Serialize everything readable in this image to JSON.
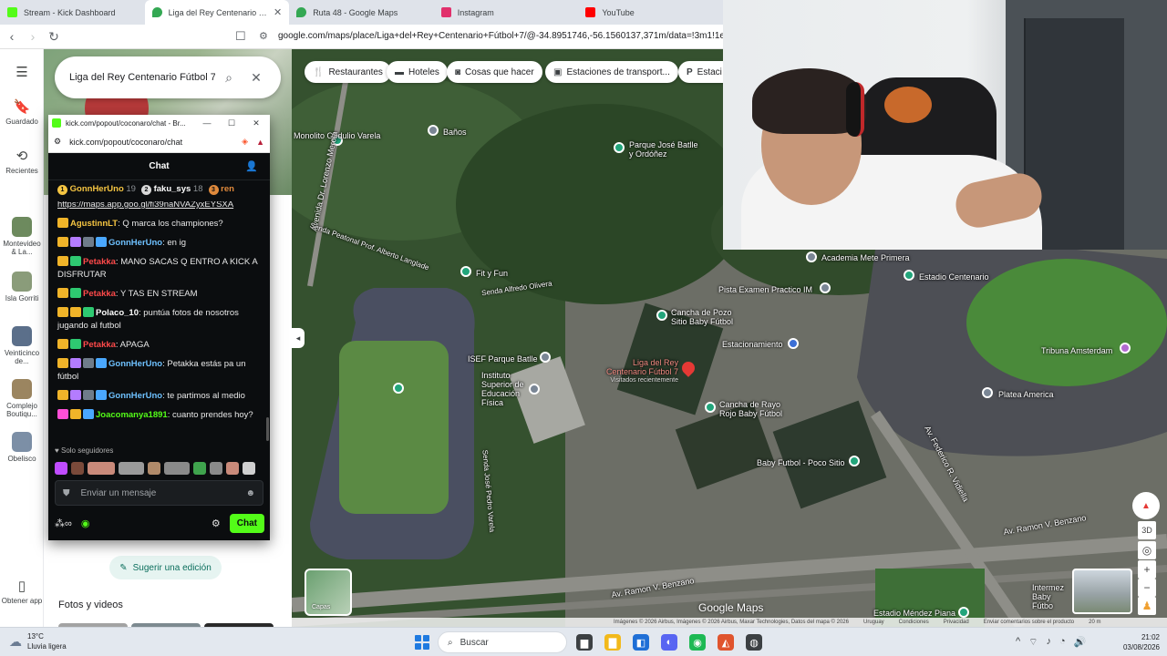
{
  "browser": {
    "tabs": [
      {
        "title": "Stream - Kick Dashboard",
        "color": "#53fc18"
      },
      {
        "title": "Liga del Rey Centenario Fútbol 7",
        "color": "#34a853"
      },
      {
        "title": "Ruta 48 - Google Maps",
        "color": "#34a853"
      },
      {
        "title": "Instagram",
        "color": "#e1306c"
      },
      {
        "title": "YouTube",
        "color": "#ff0000"
      }
    ],
    "url": "google.com/maps/place/Liga+del+Rey+Centenario+Fútbol+7/@-34.8951746,-56.1560137,371m/data=!3m1!1e3!4m6"
  },
  "rail": {
    "menu_icon": "hamburger-icon",
    "items": [
      {
        "label": "Guardado",
        "icon": "bookmark-icon"
      },
      {
        "label": "Recientes",
        "icon": "history-icon"
      },
      {
        "label": "Montevideo & La...",
        "thumb": "#6d8a5e"
      },
      {
        "label": "Isla Gorriti",
        "thumb": "#8a9c7a"
      },
      {
        "label": "Veinticinco de...",
        "thumb": "#5b6f8a"
      },
      {
        "label": "Complejo Boutiqu...",
        "thumb": "#9b8560"
      },
      {
        "label": "Obelisco",
        "thumb": "#7c8fa6"
      }
    ],
    "app_label": "Obtener app"
  },
  "panel": {
    "search_text": "Liga del Rey Centenario Fútbol 7",
    "suggest_label": "Sugerir una edición",
    "photos_title": "Fotos y videos"
  },
  "map": {
    "chips": [
      "Restaurantes",
      "Hoteles",
      "Cosas que hacer",
      "Estaciones de transport...",
      "Estaci"
    ],
    "labels": {
      "monolito": "Monolito Obdulio Varela",
      "banos": "Baños",
      "parque": "Parque José Batlle y Ordóñez",
      "fit": "Fit y Fun",
      "academia": "Academia Mete Primera",
      "estadio": "Estadio Centenario",
      "pista": "Pista Examen Practico IM",
      "cancha_pozo": "Cancha de Pozo Sitio Baby Fútbol",
      "estacionamiento": "Estacionamiento",
      "isef": "ISEF Parque Batlle",
      "instituto": "Instituto Superior de Educación Física",
      "liga": "Liga del Rey Centenario Fútbol 7",
      "liga_sub": "Visitados recientemente",
      "cancha_rayo": "Cancha de Rayo Rojo Baby Fútbol",
      "tribuna": "Tribuna Amsterdam",
      "platea": "Platea America",
      "baby": "Baby Futbol - Poco Sitio",
      "intermez": "Intermez Baby Fútbo",
      "mendez": "Estadio Méndez Piana",
      "av_benzano": "Av. Ramon V. Benzano",
      "av_benzano2": "Av. Ramon V. Benzano",
      "av_vidiella": "Av. Federico R. Vidiella",
      "av_merola": "Avenida Dr. Lorenzo Merola",
      "senda1": "Senda Peatonal Prof. Alberto Langlade",
      "senda2": "Senda Alfredo Olivera",
      "senda3": "Senda José Pedro Varela"
    },
    "layers_label": "Capas",
    "logo": "Google Maps",
    "attribution": [
      "Imágenes © 2026 Airbus, Imágenes © 2026 Airbus, Maxar Technologies, Datos del mapa © 2026",
      "Uruguay",
      "Condiciones",
      "Privacidad",
      "Enviar comentarios sobre el producto",
      "20 m"
    ],
    "controls": [
      "3D",
      "+",
      "−"
    ]
  },
  "kick": {
    "window_title": "kick.com/popout/coconaro/chat - Br...",
    "url": "kick.com/popout/coconaro/chat",
    "chat_title": "Chat",
    "leaders": [
      {
        "name": "GonnHerUno",
        "count": "19",
        "badge_color": "#f5c542",
        "name_color": "#f5c542"
      },
      {
        "name": "faku_sys",
        "count": "18",
        "badge_color": "#d9d9d9",
        "name_color": "#ffffff"
      },
      {
        "name": "ren",
        "count": "",
        "badge_color": "#e08a3c",
        "name_color": "#e08a3c"
      }
    ],
    "link_text": "https://maps.app.goo.gl/fi39naNVAZyxEYSXA",
    "messages": [
      {
        "user": "AgustinnLT",
        "color": "#f5c542",
        "text": ": Q marca los championes?",
        "badges": [
          "#f0b429"
        ]
      },
      {
        "user": "GonnHerUno",
        "color": "#6ec1ff",
        "text": ": en ig",
        "badges": [
          "#f0b429",
          "#b47cff",
          "#6f7c8a",
          "#4aa8ff"
        ]
      },
      {
        "user": "Petakka",
        "color": "#ff4a4a",
        "text": ": MANO SACAS Q ENTRO A KICK A DISFRUTAR",
        "badges": [
          "#f0b429",
          "#2ec971"
        ]
      },
      {
        "user": "Petakka",
        "color": "#ff4a4a",
        "text": ": Y TAS EN STREAM",
        "badges": [
          "#f0b429",
          "#2ec971"
        ]
      },
      {
        "user": "Polaco_10",
        "color": "#ffffff",
        "text": ": puntúa fotos de nosotros jugando al futbol",
        "badges": [
          "#f0b429",
          "#f0b429",
          "#2ec971"
        ]
      },
      {
        "user": "Petakka",
        "color": "#ff4a4a",
        "text": ": APAGA",
        "badges": [
          "#f0b429",
          "#2ec971"
        ]
      },
      {
        "user": "GonnHerUno",
        "color": "#6ec1ff",
        "text": ": Petakka estás pa un fútbol",
        "badges": [
          "#f0b429",
          "#b47cff",
          "#6f7c8a",
          "#4aa8ff"
        ]
      },
      {
        "user": "GonnHerUno",
        "color": "#6ec1ff",
        "text": ": te partimos al medio",
        "badges": [
          "#f0b429",
          "#b47cff",
          "#6f7c8a",
          "#4aa8ff"
        ]
      },
      {
        "user": "Joacomanya1891",
        "color": "#53fc18",
        "text": ": cuanto prendes hoy?",
        "badges": [
          "#ff4fd8",
          "#f0b429",
          "#4aa8ff"
        ]
      }
    ],
    "followers_label": "Solo seguidores",
    "emotes": [
      "#c04cff",
      "#7a4a3a",
      "#c98a7a",
      "#9a9a9a",
      "#b08a6a",
      "#8a8a8a",
      "#3fa34d",
      "#8a8a8a",
      "#c98a7a",
      "#cfcfcf"
    ],
    "input_placeholder": "Enviar un mensaje",
    "chat_button": "Chat"
  },
  "taskbar": {
    "weather_temp": "13°C",
    "weather_desc": "Lluvia ligera",
    "search_label": "Buscar",
    "time": "21:02",
    "date": "03/08/2026",
    "apps": [
      "#3c4043",
      "#f2b91b",
      "#1f6fd6",
      "#5865f2",
      "#1db954",
      "#e0542d",
      "#3c4043"
    ]
  }
}
